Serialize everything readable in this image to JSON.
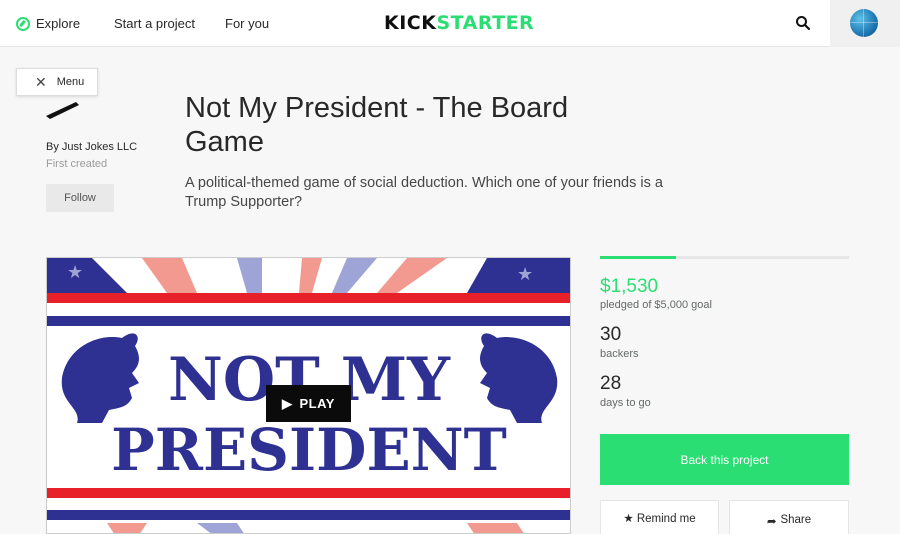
{
  "nav": {
    "explore": "Explore",
    "start_project": "Start a project",
    "for_you": "For you",
    "logo_left": "KICK",
    "logo_right": "STARTER",
    "search_icon": "search-icon",
    "avatar_icon": "globe-avatar"
  },
  "menu": {
    "label": "Menu",
    "icon": "close-icon"
  },
  "creator": {
    "name": "By Just Jokes LLC",
    "first_created": "First created",
    "follow": "Follow"
  },
  "project": {
    "title": "Not My President - The Board Game",
    "blurb": "A political-themed game of social deduction. Which one of your friends is a Trump Supporter?",
    "video_text_1": "NOT MY",
    "video_text_2": "PRESIDENT",
    "play_label": "PLAY"
  },
  "stats": {
    "progress_fraction": 0.306,
    "pledged": "$1,530",
    "pledged_sub": "pledged of $5,000 goal",
    "backers": "30",
    "backers_sub": "backers",
    "days": "28",
    "days_sub": "days to go"
  },
  "actions": {
    "back": "Back this project",
    "remind": "Remind me",
    "share": "Share"
  },
  "colors": {
    "brand_green": "#2bde73",
    "flag_blue": "#2e3192",
    "flag_red": "#e8202a"
  }
}
